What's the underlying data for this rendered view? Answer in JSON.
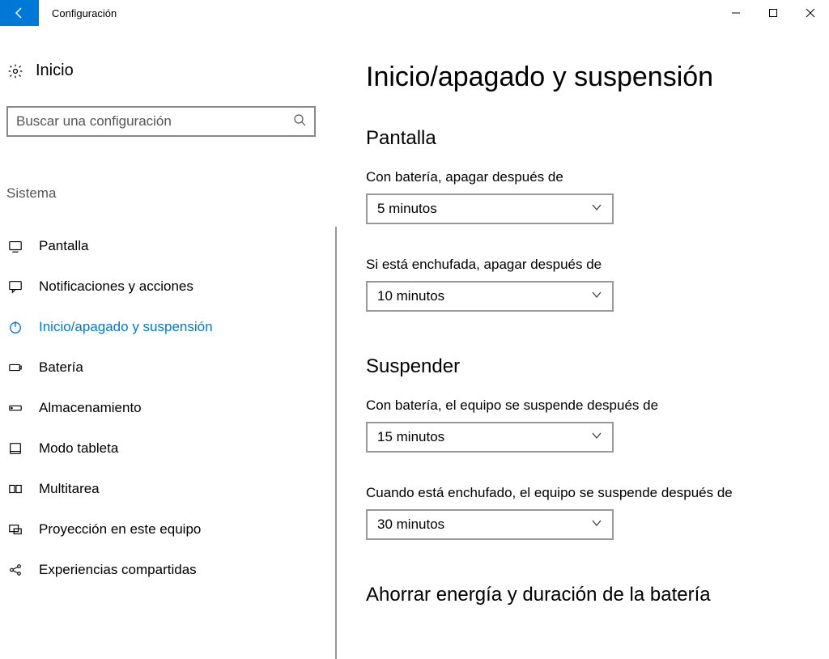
{
  "window": {
    "title": "Configuración"
  },
  "sidebar": {
    "home": "Inicio",
    "search_placeholder": "Buscar una configuración",
    "section": "Sistema",
    "items": [
      {
        "label": "Pantalla"
      },
      {
        "label": "Notificaciones y acciones"
      },
      {
        "label": "Inicio/apagado y suspensión"
      },
      {
        "label": "Batería"
      },
      {
        "label": "Almacenamiento"
      },
      {
        "label": "Modo tableta"
      },
      {
        "label": "Multitarea"
      },
      {
        "label": "Proyección en este equipo"
      },
      {
        "label": "Experiencias compartidas"
      }
    ]
  },
  "main": {
    "heading": "Inicio/apagado y suspensión",
    "screen_section": "Pantalla",
    "screen_battery_label": "Con batería, apagar después de",
    "screen_battery_value": "5 minutos",
    "screen_plugged_label": "Si está enchufada, apagar después de",
    "screen_plugged_value": "10 minutos",
    "sleep_section": "Suspender",
    "sleep_battery_label": "Con batería, el equipo se suspende después de",
    "sleep_battery_value": "15 minutos",
    "sleep_plugged_label": "Cuando está enchufado, el equipo se suspende después de",
    "sleep_plugged_value": "30 minutos",
    "save_section": "Ahorrar energía y duración de la batería"
  }
}
